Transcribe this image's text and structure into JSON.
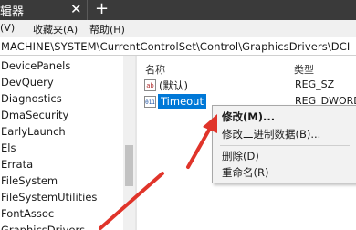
{
  "window": {
    "title": "辑器",
    "close_glyph": "✕",
    "new_tab_glyph": "+"
  },
  "menu": {
    "items": [
      "(V)",
      "收藏夹(A)",
      "帮助(H)"
    ]
  },
  "address": {
    "path": "MACHINE\\SYSTEM\\CurrentControlSet\\Control\\GraphicsDrivers\\DCI"
  },
  "tree": {
    "items": [
      "DevicePanels",
      "DevQuery",
      "Diagnostics",
      "DmaSecurity",
      "EarlyLaunch",
      "Els",
      "Errata",
      "FileSystem",
      "FileSystemUtilities",
      "FontAssoc",
      "GraphicsDrivers"
    ]
  },
  "list": {
    "headers": {
      "name": "名称",
      "type": "类型"
    },
    "rows": [
      {
        "name": "(默认)",
        "type": "REG_SZ",
        "icon": "string-value-icon"
      },
      {
        "name": "Timeout",
        "type": "REG_DWORD",
        "icon": "binary-value-icon"
      }
    ]
  },
  "context_menu": {
    "items": [
      "修改(M)...",
      "修改二进制数据(B)...",
      "删除(D)",
      "重命名(R)"
    ]
  },
  "colors": {
    "selection": "#0078d7",
    "arrow": "#e0342a",
    "titlebar": "#3a3a3a"
  }
}
